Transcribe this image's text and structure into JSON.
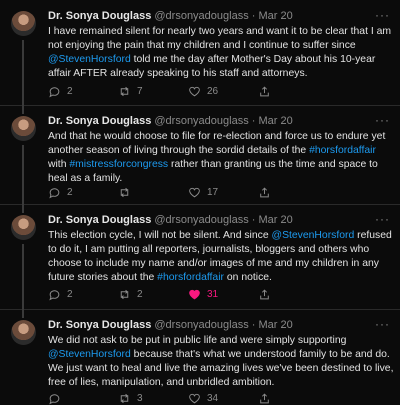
{
  "tweets": [
    {
      "name": "Dr. Sonya Douglass",
      "handle": "@drsonyadouglass",
      "dot": "·",
      "date": "Mar 20",
      "text": [
        {
          "t": "I have remained silent for nearly two years and want it to be clear that I am not enjoying the pain that my children and I continue to suffer since "
        },
        {
          "t": "@StevenHorsford",
          "link": true
        },
        {
          "t": " told me the day after Mother's Day about his 10-year affair AFTER already speaking to his staff and attorneys."
        }
      ],
      "replies": "2",
      "retweets": "7",
      "likes": "26",
      "liked": false
    },
    {
      "name": "Dr. Sonya Douglass",
      "handle": "@drsonyadouglass",
      "dot": "·",
      "date": "Mar 20",
      "text": [
        {
          "t": "And that he would choose to file for re-election and force us to endure yet another season of living through the sordid details of the "
        },
        {
          "t": "#horsfordaffair",
          "link": true
        },
        {
          "t": " with "
        },
        {
          "t": "#mistressforcongress",
          "link": true
        },
        {
          "t": " rather than granting us the time and space to heal as a family."
        }
      ],
      "replies": "2",
      "retweets": "",
      "likes": "17",
      "liked": false
    },
    {
      "name": "Dr. Sonya Douglass",
      "handle": "@drsonyadouglass",
      "dot": "·",
      "date": "Mar 20",
      "text": [
        {
          "t": "This election cycle, I will not be silent. And since "
        },
        {
          "t": "@StevenHorsford",
          "link": true
        },
        {
          "t": " refused to do it, I am putting all reporters, journalists, bloggers and others who choose to include my name and/or images of me and my children in any future stories about the "
        },
        {
          "t": "#horsfordaffair",
          "link": true
        },
        {
          "t": " on notice."
        }
      ],
      "replies": "2",
      "retweets": "2",
      "likes": "31",
      "liked": true
    },
    {
      "name": "Dr. Sonya Douglass",
      "handle": "@drsonyadouglass",
      "dot": "·",
      "date": "Mar 20",
      "text": [
        {
          "t": "We did not ask to be put in public life and were simply supporting "
        },
        {
          "t": "@StevenHorsford",
          "link": true
        },
        {
          "t": " because that's what we understood family to be and do. We just want to heal and live the amazing lives we've been destined to live, free of lies, manipulation, and unbridled ambition."
        }
      ],
      "replies": "",
      "retweets": "3",
      "likes": "34",
      "liked": false
    }
  ],
  "colors": {
    "link": "#1d9bf0",
    "like_active": "#f91880",
    "muted": "#8b8b8b",
    "background": "#0b0b0b"
  },
  "icons": {
    "reply": "reply-icon",
    "retweet": "retweet-icon",
    "like": "heart-icon",
    "share": "share-icon",
    "more": "more-icon"
  },
  "more_glyph": "···"
}
